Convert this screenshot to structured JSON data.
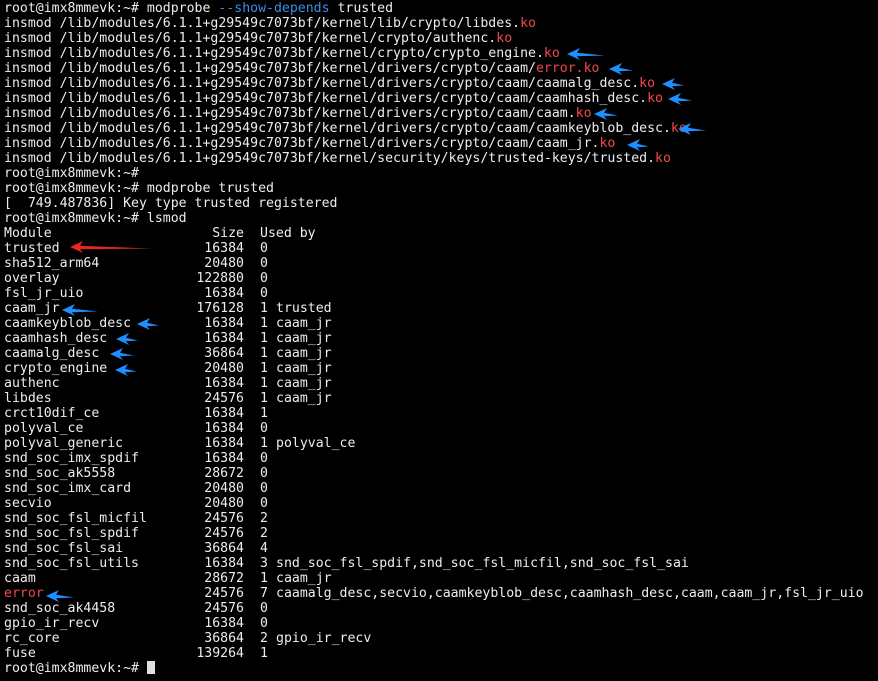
{
  "terminal": {
    "prompt": "root@imx8mmevk:~# ",
    "cmd1_part1": "modprobe ",
    "cmd1_flag": "--show-depends",
    "cmd1_part2": " trusted",
    "insmod_lines": [
      {
        "path": "insmod /lib/modules/6.1.1+g29549c7073bf/kernel/lib/crypto/libdes.",
        "ext": "ko"
      },
      {
        "path": "insmod /lib/modules/6.1.1+g29549c7073bf/kernel/crypto/authenc.",
        "ext": "ko"
      },
      {
        "path": "insmod /lib/modules/6.1.1+g29549c7073bf/kernel/crypto/crypto_engine.",
        "ext": "ko"
      },
      {
        "path": "insmod /lib/modules/6.1.1+g29549c7073bf/kernel/drivers/crypto/caam/",
        "ext": "error.ko"
      },
      {
        "path": "insmod /lib/modules/6.1.1+g29549c7073bf/kernel/drivers/crypto/caam/caamalg_desc.",
        "ext": "ko"
      },
      {
        "path": "insmod /lib/modules/6.1.1+g29549c7073bf/kernel/drivers/crypto/caam/caamhash_desc.",
        "ext": "ko"
      },
      {
        "path": "insmod /lib/modules/6.1.1+g29549c7073bf/kernel/drivers/crypto/caam/caam.",
        "ext": "ko"
      },
      {
        "path": "insmod /lib/modules/6.1.1+g29549c7073bf/kernel/drivers/crypto/caam/caamkeyblob_desc.",
        "ext": "ko"
      },
      {
        "path": "insmod /lib/modules/6.1.1+g29549c7073bf/kernel/drivers/crypto/caam/caam_jr.",
        "ext": "ko"
      },
      {
        "path": "insmod /lib/modules/6.1.1+g29549c7073bf/kernel/security/keys/trusted-keys/trusted.",
        "ext": "ko"
      }
    ],
    "cmd2": "modprobe trusted",
    "dmesg": "[  749.487836] Key type trusted registered",
    "cmd3": "lsmod",
    "lsmod_header": {
      "module": "Module",
      "size": "Size",
      "used": "Used by"
    },
    "lsmod": [
      {
        "name": "trusted",
        "size": "16384",
        "count": "0",
        "by": ""
      },
      {
        "name": "sha512_arm64",
        "size": "20480",
        "count": "0",
        "by": ""
      },
      {
        "name": "overlay",
        "size": "122880",
        "count": "0",
        "by": ""
      },
      {
        "name": "fsl_jr_uio",
        "size": "16384",
        "count": "0",
        "by": ""
      },
      {
        "name": "caam_jr",
        "size": "176128",
        "count": "1",
        "by": "trusted"
      },
      {
        "name": "caamkeyblob_desc",
        "size": "16384",
        "count": "1",
        "by": "caam_jr"
      },
      {
        "name": "caamhash_desc",
        "size": "16384",
        "count": "1",
        "by": "caam_jr"
      },
      {
        "name": "caamalg_desc",
        "size": "36864",
        "count": "1",
        "by": "caam_jr"
      },
      {
        "name": "crypto_engine",
        "size": "20480",
        "count": "1",
        "by": "caam_jr"
      },
      {
        "name": "authenc",
        "size": "16384",
        "count": "1",
        "by": "caam_jr"
      },
      {
        "name": "libdes",
        "size": "24576",
        "count": "1",
        "by": "caam_jr"
      },
      {
        "name": "crct10dif_ce",
        "size": "16384",
        "count": "1",
        "by": ""
      },
      {
        "name": "polyval_ce",
        "size": "16384",
        "count": "0",
        "by": ""
      },
      {
        "name": "polyval_generic",
        "size": "16384",
        "count": "1",
        "by": "polyval_ce"
      },
      {
        "name": "snd_soc_imx_spdif",
        "size": "16384",
        "count": "0",
        "by": ""
      },
      {
        "name": "snd_soc_ak5558",
        "size": "28672",
        "count": "0",
        "by": ""
      },
      {
        "name": "snd_soc_imx_card",
        "size": "20480",
        "count": "0",
        "by": ""
      },
      {
        "name": "secvio",
        "size": "20480",
        "count": "0",
        "by": ""
      },
      {
        "name": "snd_soc_fsl_micfil",
        "size": "24576",
        "count": "2",
        "by": ""
      },
      {
        "name": "snd_soc_fsl_spdif",
        "size": "24576",
        "count": "2",
        "by": ""
      },
      {
        "name": "snd_soc_fsl_sai",
        "size": "36864",
        "count": "4",
        "by": ""
      },
      {
        "name": "snd_soc_fsl_utils",
        "size": "16384",
        "count": "3",
        "by": "snd_soc_fsl_spdif,snd_soc_fsl_micfil,snd_soc_fsl_sai"
      },
      {
        "name": "caam",
        "size": "28672",
        "count": "1",
        "by": "caam_jr"
      },
      {
        "name": "error",
        "size": "24576",
        "count": "7",
        "by": "caamalg_desc,secvio,caamkeyblob_desc,caamhash_desc,caam,caam_jr,fsl_jr_uio"
      },
      {
        "name": "snd_soc_ak4458",
        "size": "24576",
        "count": "0",
        "by": ""
      },
      {
        "name": "gpio_ir_recv",
        "size": "16384",
        "count": "0",
        "by": ""
      },
      {
        "name": "rc_core",
        "size": "36864",
        "count": "2",
        "by": "gpio_ir_recv"
      },
      {
        "name": "fuse",
        "size": "139264",
        "count": "1",
        "by": ""
      }
    ]
  },
  "colors": {
    "background": "#000000",
    "text": "#ededed",
    "ko_highlight": "#f0494c",
    "flag_highlight": "#3b8ee8",
    "arrow_blue": "#1e8fff",
    "arrow_red": "#e8261c"
  }
}
